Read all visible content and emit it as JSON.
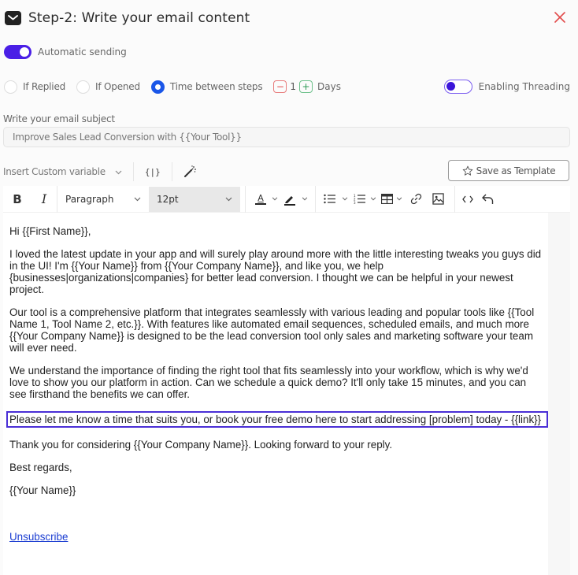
{
  "header": {
    "title": "Step-2: Write your email content",
    "icon": "mail-icon",
    "close_icon": "close-icon"
  },
  "automatic_sending": {
    "label": "Automatic sending",
    "enabled": true
  },
  "conditions": {
    "options": [
      {
        "label": "If Replied",
        "selected": false
      },
      {
        "label": "If Opened",
        "selected": false
      },
      {
        "label": "Time between steps",
        "selected": true
      }
    ],
    "stepper": {
      "minus": "−",
      "value": "1",
      "plus": "+",
      "unit": "Days"
    },
    "threading": {
      "label": "Enabling Threading",
      "enabled": false
    }
  },
  "subject": {
    "label": "Write your email subject",
    "value": "Improve Sales Lead Conversion with {{Your Tool}}"
  },
  "variables": {
    "label": "Insert Custom variable",
    "braces": "{|}",
    "ai_icon": "magic-wand-icon"
  },
  "save_template": {
    "label": "Save as Template",
    "icon": "star-icon"
  },
  "toolbar": {
    "bold": "B",
    "italic": "I",
    "block_format": "Paragraph",
    "font_size": "12pt",
    "text_color": "A"
  },
  "body": {
    "greeting": "Hi {{First Name}},",
    "paragraphs": [
      "I loved the latest update in your app and will surely play around more with the little interesting tweaks you guys did in the UI! I'm {{Your Name}} from {{Your Company Name}}, and like you, we help {businesses|organizations|companies} for better lead conversion. I thought we can be helpful in your newest project.",
      "Our tool is a comprehensive platform that integrates seamlessly with various leading and popular tools like {{Tool Name 1, Tool Name 2, etc.}}. With features like automated email sequences, scheduled emails, and much more {{Your Company Name}} is designed to be the lead conversion tool only sales and marketing software your team will ever need.",
      "We understand the importance of finding the right tool that fits seamlessly into your workflow, which is why we'd love to show you our platform in action. Can we schedule a quick demo? It'll only take 15 minutes, and you can see firsthand the benefits we can offer."
    ],
    "highlighted": "Please let me know a time that suits you, or book your free demo here to start addressing [problem] today - {{link}}",
    "thanks": "Thank you for considering {{Your Company Name}}. Looking forward to your reply.",
    "signoff": "Best regards,",
    "signature": "{{Your Name}}",
    "unsubscribe": "Unsubscribe"
  },
  "colors": {
    "accent": "#4a1fe6",
    "radio_selected": "#1a56e8",
    "close": "#e24c4c",
    "stepper_minus": "#e24c4c",
    "stepper_plus": "#2f9b57",
    "link": "#1a3cd1",
    "highlight_border": "#4a2fd6"
  }
}
